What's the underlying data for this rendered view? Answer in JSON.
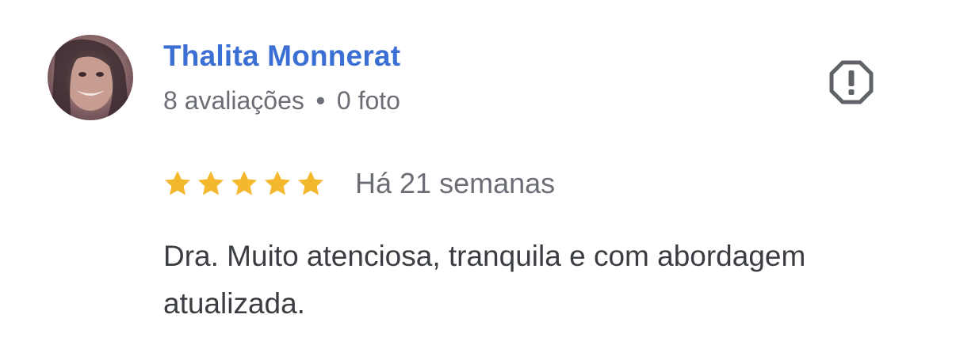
{
  "reviewer": {
    "name": "Thalita Monnerat",
    "reviews_count": "8 avaliações",
    "separator": "•",
    "photos_count": "0 foto"
  },
  "review": {
    "rating": 5,
    "rating_max": 5,
    "date": "Há 21 semanas",
    "text": "Dra. Muito atenciosa, tranquila e com abordagem atualizada."
  },
  "icons": {
    "report": "report-octagon-icon",
    "star": "star-icon"
  },
  "colors": {
    "name": "#3b6fd4",
    "star": "#f4b82e",
    "meta": "#6b6f75",
    "text": "#3a3d42",
    "icon": "#5f6368"
  }
}
